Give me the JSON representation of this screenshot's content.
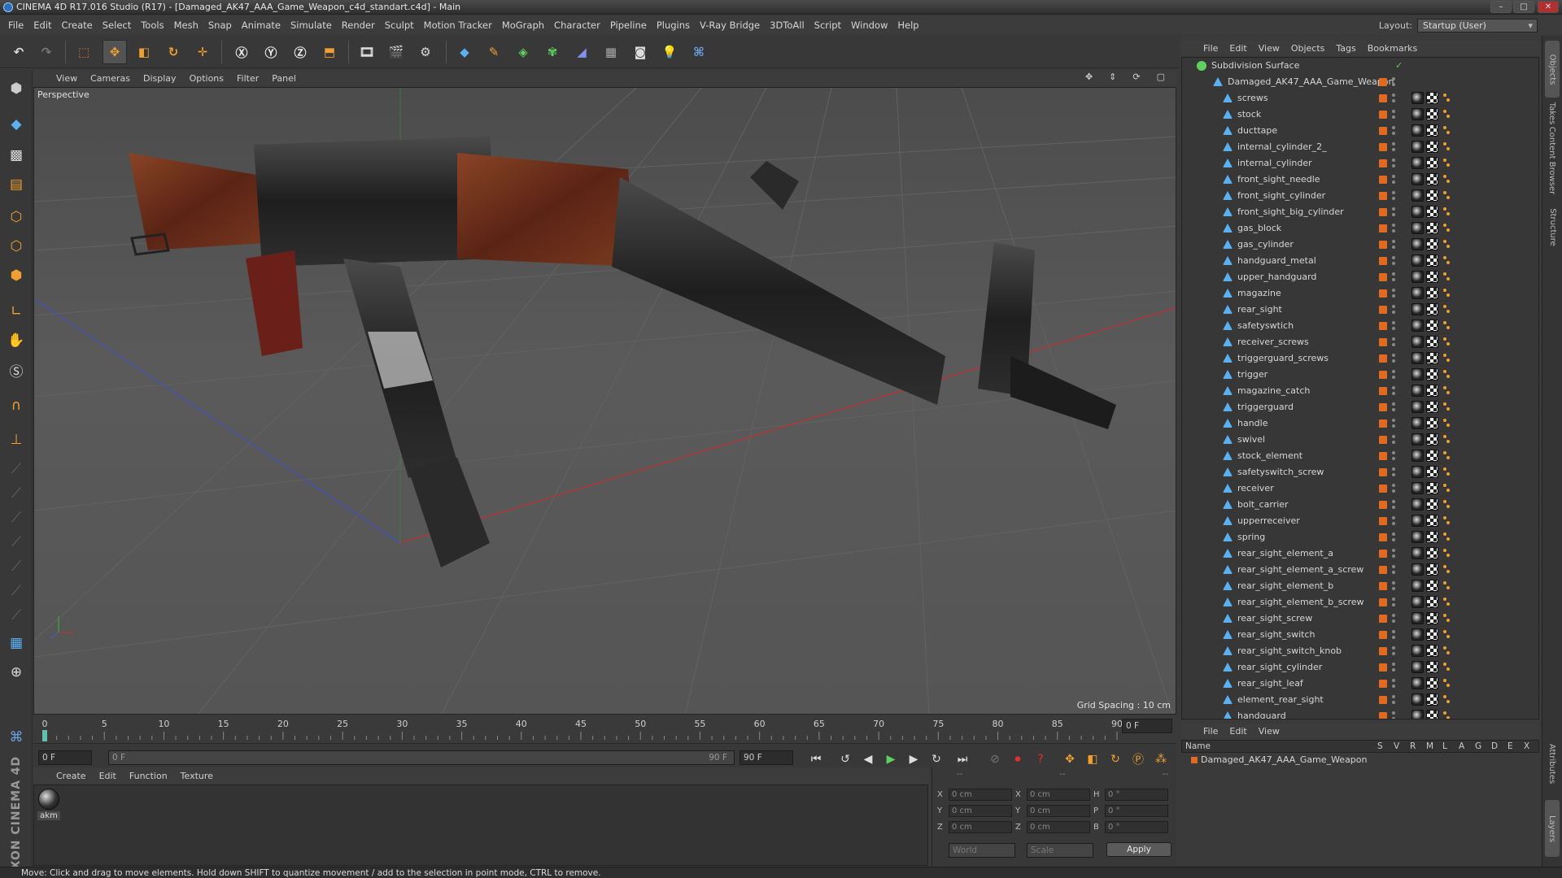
{
  "window": {
    "title": "CINEMA 4D R17.016 Studio (R17) - [Damaged_AK47_AAA_Game_Weapon_c4d_standart.c4d] - Main"
  },
  "menubar": [
    "File",
    "Edit",
    "Create",
    "Select",
    "Tools",
    "Mesh",
    "Snap",
    "Animate",
    "Simulate",
    "Render",
    "Sculpt",
    "Motion Tracker",
    "MoGraph",
    "Character",
    "Pipeline",
    "Plugins",
    "V-Ray Bridge",
    "3DToAll",
    "Script",
    "Window",
    "Help"
  ],
  "layout": {
    "label": "Layout:",
    "value": "Startup (User)"
  },
  "viewport": {
    "menu": [
      "View",
      "Cameras",
      "Display",
      "Options",
      "Filter",
      "Panel"
    ],
    "label": "Perspective",
    "grid_spacing": "Grid Spacing : 10 cm"
  },
  "timeline": {
    "ticks": [
      "0",
      "5",
      "10",
      "15",
      "20",
      "25",
      "30",
      "35",
      "40",
      "45",
      "50",
      "55",
      "60",
      "65",
      "70",
      "75",
      "80",
      "85",
      "90"
    ],
    "end_frame_field": "0 F",
    "current_frame": "0 F",
    "range_start": "0 F",
    "range_end": "90 F",
    "max_frame": "90 F"
  },
  "material_manager": {
    "menu": [
      "Create",
      "Edit",
      "Function",
      "Texture"
    ],
    "materials": [
      {
        "name": "akm"
      }
    ]
  },
  "coords": {
    "header": [
      "--",
      "--",
      "--"
    ],
    "rows": [
      {
        "a": "X",
        "av": "0 cm",
        "b": "X",
        "bv": "0 cm",
        "c": "H",
        "cv": "0 °"
      },
      {
        "a": "Y",
        "av": "0 cm",
        "b": "Y",
        "bv": "0 cm",
        "c": "P",
        "cv": "0 °"
      },
      {
        "a": "Z",
        "av": "0 cm",
        "b": "Z",
        "bv": "0 cm",
        "c": "B",
        "cv": "0 °"
      }
    ],
    "mode1": "World",
    "mode2": "Scale",
    "apply": "Apply"
  },
  "object_manager": {
    "menu": [
      "File",
      "Edit",
      "View",
      "Objects",
      "Tags",
      "Bookmarks"
    ],
    "root": "Subdivision Surface",
    "group": "Damaged_AK47_AAA_Game_Weapon",
    "objects": [
      "screws",
      "stock",
      "ducttape",
      "internal_cylinder_2_",
      "internal_cylinder",
      "front_sight_needle",
      "front_sight_cylinder",
      "front_sight_big_cylinder",
      "gas_block",
      "gas_cylinder",
      "handguard_metal",
      "upper_handguard",
      "magazine",
      "rear_sight",
      "safetyswtich",
      "receiver_screws",
      "triggerguard_screws",
      "trigger",
      "magazine_catch",
      "triggerguard",
      "handle",
      "swivel",
      "stock_element",
      "safetyswitch_screw",
      "receiver",
      "bolt_carrier",
      "upperreceiver",
      "spring",
      "rear_sight_element_a",
      "rear_sight_element_a_screw",
      "rear_sight_element_b",
      "rear_sight_element_b_screw",
      "rear_sight_screw",
      "rear_sight_switch",
      "rear_sight_switch_knob",
      "rear_sight_cylinder",
      "rear_sight_leaf",
      "element_rear_sight",
      "handguard"
    ]
  },
  "right_tabs": [
    "Objects",
    "Takes",
    "Content Browser",
    "Structure",
    "Attributes",
    "Layers"
  ],
  "layer_manager": {
    "menu": [
      "File",
      "Edit",
      "View"
    ],
    "columns": [
      "Name",
      "S",
      "V",
      "R",
      "M",
      "L",
      "A",
      "G",
      "D",
      "E",
      "X"
    ],
    "layer": "Damaged_AK47_AAA_Game_Weapon"
  },
  "status": "Move: Click and drag to move elements. Hold down SHIFT to quantize movement / add to the selection in point mode, CTRL to remove.",
  "colors": {
    "accent": "#f0a030",
    "tag": "#e06a20",
    "bg": "#3a3a3a"
  }
}
